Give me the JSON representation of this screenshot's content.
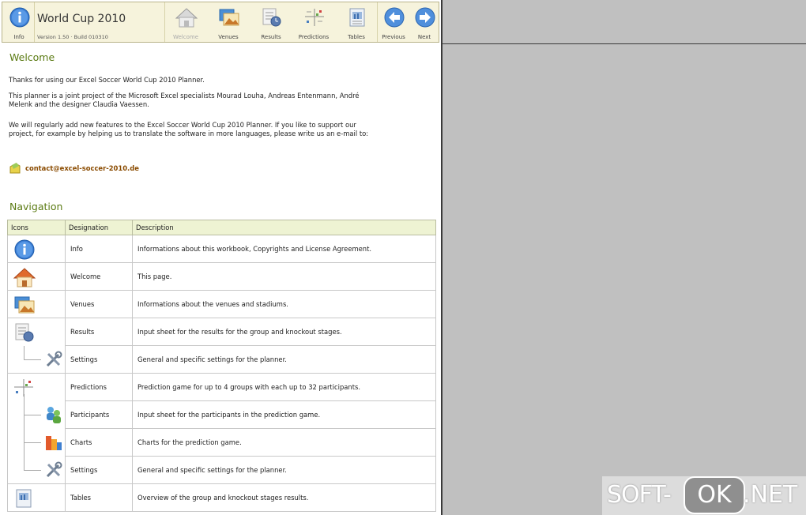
{
  "toolbar": {
    "info_label": "Info",
    "title": "World Cup 2010",
    "version": "Version 1.50 · Build 010310",
    "buttons": {
      "welcome": "Welcome",
      "venues": "Venues",
      "results": "Results",
      "predictions": "Predictions",
      "tables": "Tables",
      "previous": "Previous",
      "next": "Next"
    }
  },
  "welcome": {
    "heading": "Welcome",
    "p1": "Thanks for using our Excel Soccer World Cup 2010 Planner.",
    "p2": "This planner is a joint project of the Microsoft Excel specialists Mourad Louha, Andreas Entenmann, André Melenk and the designer Claudia Vaessen.",
    "p3": "We will regularly add new features to the Excel Soccer World Cup 2010 Planner. If you like to support our project, for example by helping us to translate the software in more languages, please write us an e-mail to:",
    "email": "contact@excel-soccer-2010.de"
  },
  "navigation": {
    "heading": "Navigation",
    "columns": [
      "Icons",
      "Designation",
      "Description"
    ],
    "rows": [
      {
        "icon": "info-icon",
        "designation": "Info",
        "description": "Informations about this workbook, Copyrights and License Agreement."
      },
      {
        "icon": "home-icon",
        "designation": "Welcome",
        "description": "This page."
      },
      {
        "icon": "venues-icon",
        "designation": "Venues",
        "description": "Informations about the venues and stadiums."
      },
      {
        "icon": "results-icon",
        "designation": "Results",
        "description": "Input sheet for the results for the group and knockout stages."
      },
      {
        "icon": "settings-icon",
        "designation": "Settings",
        "description": "General and specific settings for the planner."
      },
      {
        "icon": "predictions-icon",
        "designation": "Predictions",
        "description": "Prediction game for up to 4 groups with each up to 32 participants."
      },
      {
        "icon": "participants-icon",
        "designation": "Participants",
        "description": "Input sheet for the participants in the prediction game."
      },
      {
        "icon": "charts-icon",
        "designation": "Charts",
        "description": "Charts for the prediction game."
      },
      {
        "icon": "settings-icon",
        "designation": "Settings",
        "description": "General and specific settings for the planner."
      },
      {
        "icon": "tables-icon",
        "designation": "Tables",
        "description": "Overview of the group and knockout stages results."
      }
    ]
  },
  "watermark": {
    "part1": "SOFT-",
    "part2": "OK",
    "part3": ".NET"
  },
  "colors": {
    "heading": "#5a7a12",
    "toolbar_bg": "#f6f3dc",
    "link": "#8a4b00"
  }
}
